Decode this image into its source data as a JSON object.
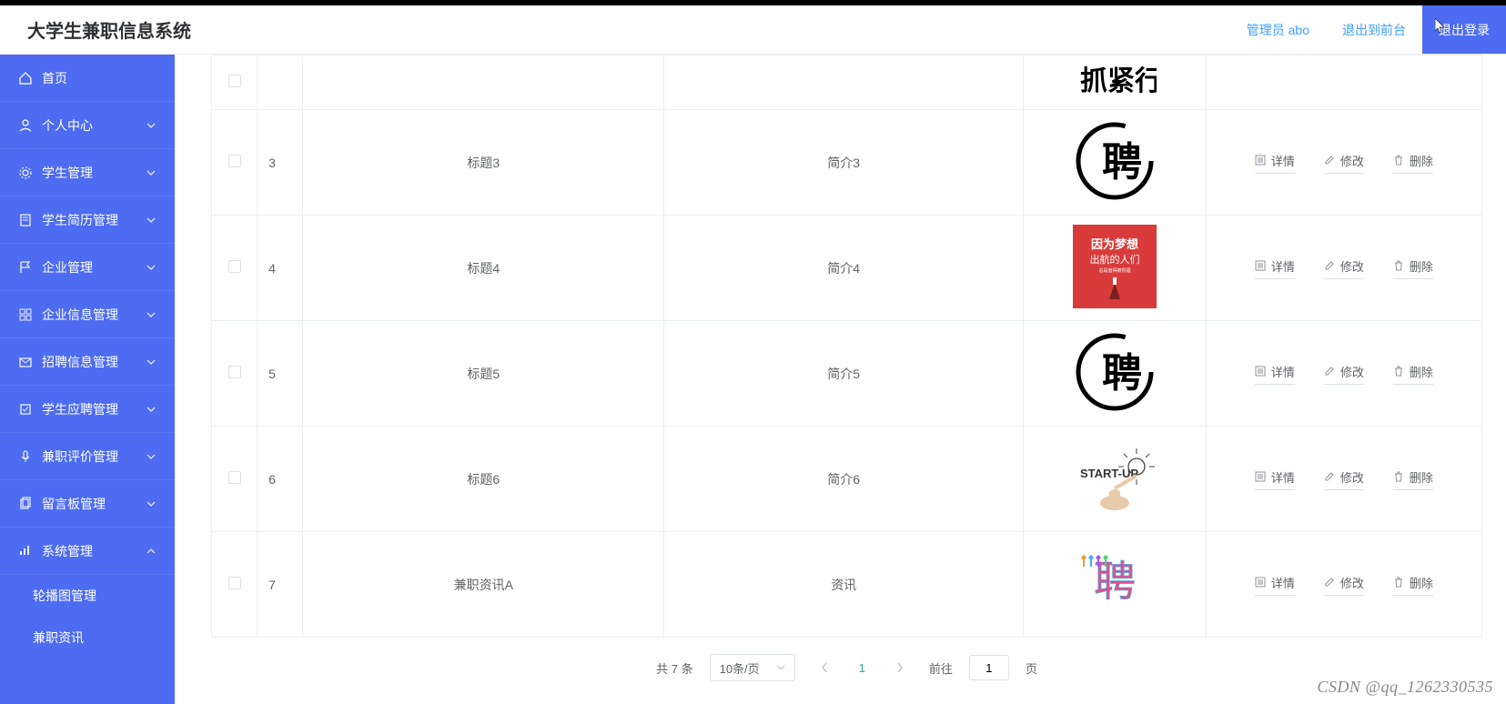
{
  "header": {
    "title": "大学生兼职信息系统",
    "admin_label": "管理员 abo",
    "to_front_label": "退出到前台",
    "logout_label": "退出登录"
  },
  "sidebar": {
    "items": [
      {
        "icon": "home",
        "label": "首页",
        "expandable": false
      },
      {
        "icon": "user",
        "label": "个人中心",
        "expandable": true,
        "open": false
      },
      {
        "icon": "gear",
        "label": "学生管理",
        "expandable": true,
        "open": false
      },
      {
        "icon": "doc",
        "label": "学生简历管理",
        "expandable": true,
        "open": false
      },
      {
        "icon": "flag",
        "label": "企业管理",
        "expandable": true,
        "open": false
      },
      {
        "icon": "grid",
        "label": "企业信息管理",
        "expandable": true,
        "open": false
      },
      {
        "icon": "mail",
        "label": "招聘信息管理",
        "expandable": true,
        "open": false
      },
      {
        "icon": "apply",
        "label": "学生应聘管理",
        "expandable": true,
        "open": false
      },
      {
        "icon": "mic",
        "label": "兼职评价管理",
        "expandable": true,
        "open": false
      },
      {
        "icon": "copy",
        "label": "留言板管理",
        "expandable": true,
        "open": false
      },
      {
        "icon": "chart",
        "label": "系统管理",
        "expandable": true,
        "open": true
      }
    ],
    "sub_items": [
      {
        "label": "轮播图管理"
      },
      {
        "label": "兼职资讯"
      }
    ]
  },
  "table": {
    "rows": [
      {
        "idx": "",
        "title": "",
        "intro": "",
        "thumb": "calligraphy-partial"
      },
      {
        "idx": "3",
        "title": "标题3",
        "intro": "简介3",
        "thumb": "calligraphy-circle"
      },
      {
        "idx": "4",
        "title": "标题4",
        "intro": "简介4",
        "thumb": "red-poster"
      },
      {
        "idx": "5",
        "title": "标题5",
        "intro": "简介5",
        "thumb": "calligraphy-circle"
      },
      {
        "idx": "6",
        "title": "标题6",
        "intro": "简介6",
        "thumb": "startup"
      },
      {
        "idx": "7",
        "title": "兼职资讯A",
        "intro": "资讯",
        "thumb": "colorful-people"
      }
    ],
    "actions": {
      "detail": "详情",
      "edit": "修改",
      "delete": "删除"
    }
  },
  "pagination": {
    "total_text": "共 7 条",
    "per_page": "10条/页",
    "current": "1",
    "jump_prefix": "前往",
    "jump_value": "1",
    "jump_suffix": "页"
  },
  "watermark": "CSDN @qq_1262330535"
}
